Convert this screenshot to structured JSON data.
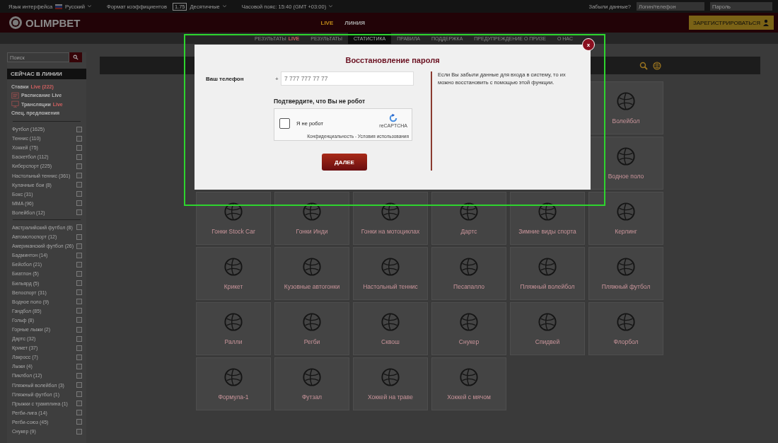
{
  "top_bar": {
    "language_label": "Язык интерфейса",
    "language": "Русский",
    "odds_label": "Формат коэффициентов",
    "odds_sample": "1.75",
    "odds_format": "Десятичные",
    "timezone": "Часовой пояс: 15:40 (GMT +03:00)",
    "forgot": "Забыли данные?",
    "login_placeholder": "Логин/телефон",
    "password_placeholder": "Пароль"
  },
  "header": {
    "logo": "OLIMPBET",
    "nav": [
      {
        "label": "LIVE",
        "selected": false
      },
      {
        "label": "ЛИНИЯ",
        "selected": true
      }
    ],
    "register": "ЗАРЕГИСТРИРОВАТЬСЯ"
  },
  "subnav": [
    {
      "label": "РЕЗУЛЬТАТЫ",
      "tag": "LIVE",
      "selected": false
    },
    {
      "label": "РЕЗУЛЬТАТЫ",
      "selected": false
    },
    {
      "label": "СТАТИСТИКА",
      "selected": true
    },
    {
      "label": "ПРАВИЛА",
      "selected": false
    },
    {
      "label": "ПОДДЕРЖКА",
      "selected": false
    },
    {
      "label": "ПРЕДУПРЕЖДЕНИЕ О ПРИЗЕ",
      "selected": false
    },
    {
      "label": "О НАС",
      "selected": false
    }
  ],
  "sidebar": {
    "search_placeholder": "Поиск",
    "title": "СЕЙЧАС В ЛИНИИ",
    "links": [
      {
        "kind": "plain",
        "label": "Ставки",
        "tag": "Live (222)"
      },
      {
        "kind": "schedule",
        "label": "Расписание Live"
      },
      {
        "kind": "broadcast",
        "label": "Трансляции",
        "tag": "Live"
      },
      {
        "kind": "plain",
        "label": "Спец. предложения"
      }
    ],
    "groups": [
      [
        {
          "label": "Футбол (1625)",
          "checked": false
        },
        {
          "label": "Теннис (110)",
          "checked": false
        },
        {
          "label": "Хоккей (75)",
          "checked": false
        },
        {
          "label": "Баскетбол (112)",
          "checked": false
        },
        {
          "label": "Киберспорт (225)",
          "checked": false
        },
        {
          "label": "Настольный теннис (361)",
          "checked": false
        },
        {
          "label": "Кулачные бои (8)",
          "checked": false
        },
        {
          "label": "Бокс (31)",
          "checked": false
        },
        {
          "label": "MMA (96)",
          "checked": false
        },
        {
          "label": "Волейбол (12)",
          "checked": false
        }
      ],
      [
        {
          "label": "Австралийский футбол (8)",
          "checked": false
        },
        {
          "label": "Автомотоспорт (12)",
          "checked": false
        },
        {
          "label": "Американский футбол (26)",
          "checked": false
        },
        {
          "label": "Бадминтон (14)",
          "checked": false
        },
        {
          "label": "Бейсбол (21)",
          "checked": false
        },
        {
          "label": "Биатлон (5)",
          "checked": false
        },
        {
          "label": "Бильярд (5)",
          "checked": false
        },
        {
          "label": "Велоспорт (31)",
          "checked": false
        },
        {
          "label": "Водное поло (9)",
          "checked": false
        },
        {
          "label": "Гандбол (85)",
          "checked": false
        },
        {
          "label": "Гольф (8)",
          "checked": false
        },
        {
          "label": "Горные лыжи (2)",
          "checked": false
        },
        {
          "label": "Дартс (32)",
          "checked": false
        },
        {
          "label": "Крикет (37)",
          "checked": false
        },
        {
          "label": "Лакросс (7)",
          "checked": false
        },
        {
          "label": "Лыжи (4)",
          "checked": false
        },
        {
          "label": "Пиклбол (12)",
          "checked": false
        },
        {
          "label": "Пляжный волейбол (3)",
          "checked": false
        },
        {
          "label": "Пляжный футбол (1)",
          "checked": false
        },
        {
          "label": "Прыжки с трамплина (1)",
          "checked": false
        },
        {
          "label": "Регби-лига (14)",
          "checked": false
        },
        {
          "label": "Регби-союз (45)",
          "checked": false
        },
        {
          "label": "Снукер (9)",
          "checked": false
        }
      ]
    ]
  },
  "sports": [
    "Волейбол",
    "Водное поло",
    "Гонки Stock Car",
    "Гонки Инди",
    "Гонки на мотоциклах",
    "Дартс",
    "Зимние виды спорта",
    "Керлинг",
    "Крикет",
    "Кузовные автогонки",
    "Настольный теннис",
    "Песапалло",
    "Пляжный волейбол",
    "Пляжный футбол",
    "Ралли",
    "Регби",
    "Сквош",
    "Снукер",
    "Спидвей",
    "Флорбол",
    "Формула-1",
    "Футзал",
    "Хоккей на траве",
    "Хоккей с мячом"
  ],
  "modal": {
    "title": "Восстановление пароля",
    "phone_label": "Ваш телефон",
    "phone_prefix": "+",
    "phone_placeholder": "7 777 777 77 77",
    "captcha_title": "Подтвердите, что Вы не робот",
    "captcha": {
      "checked": false,
      "label": "Я не робот",
      "brand": "reCAPTCHA",
      "terms": "Конфиденциальность - Условия использования"
    },
    "submit": "ДАЛЕЕ",
    "info": "Если Вы забыли данные для входа в систему, то их можно восстановить с помощью этой функции.",
    "close": "x"
  }
}
